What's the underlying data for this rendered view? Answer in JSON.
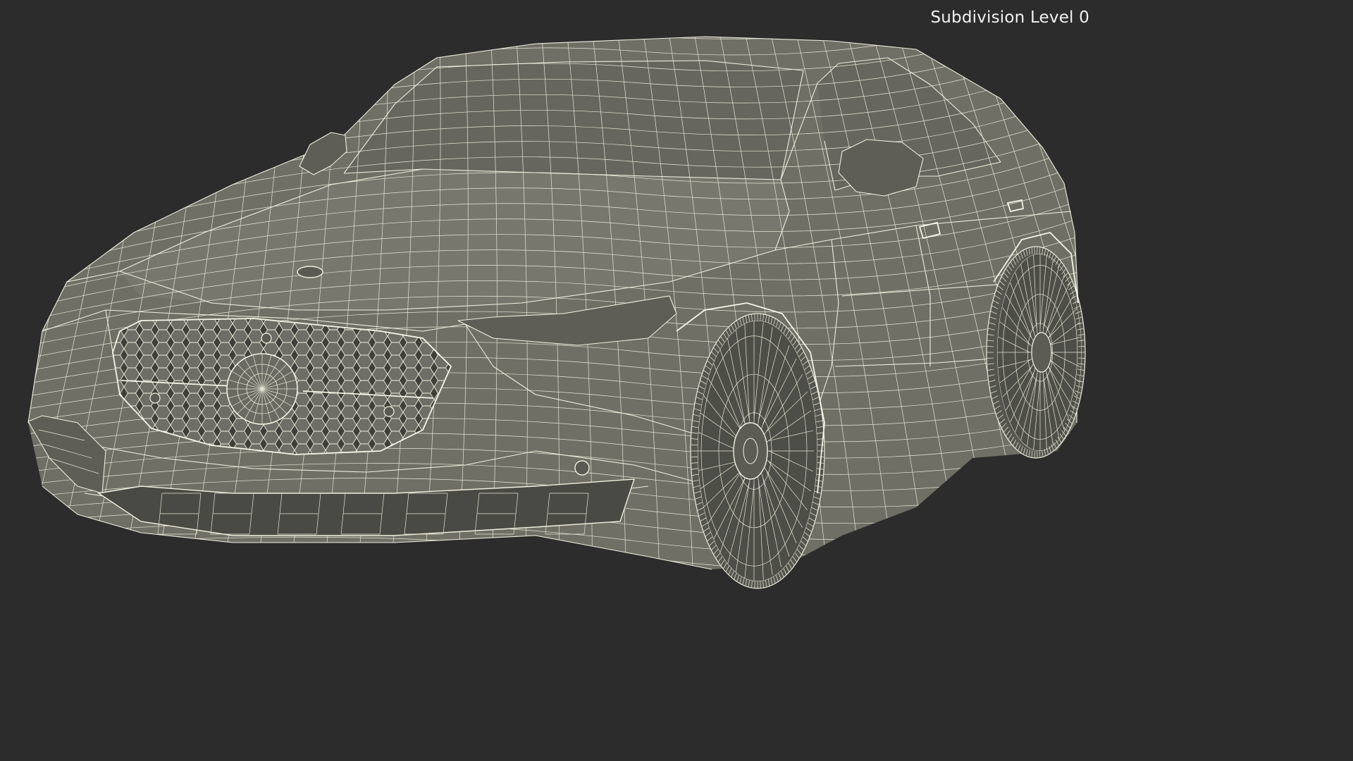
{
  "viewport": {
    "overlay_label": "Subdivision Level 0"
  },
  "scene": {
    "subject": "car-wireframe",
    "colors": {
      "background": "#2c2c2c",
      "body": "#6f6f66",
      "wire": "#eeeedd",
      "label": "#f2f2f2"
    }
  }
}
